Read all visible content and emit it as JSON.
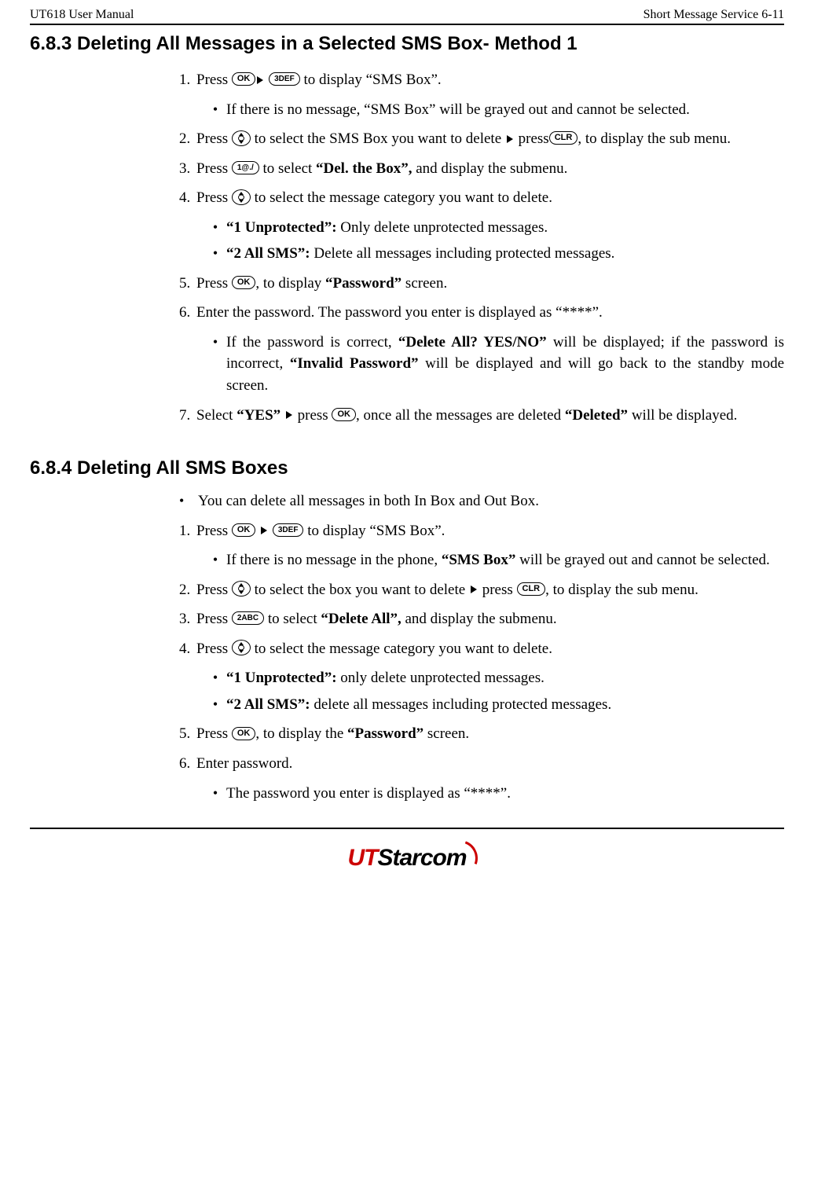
{
  "header": {
    "left": "UT618 User Manual",
    "right": "Short Message Service   6-11"
  },
  "section_683": {
    "title": "6.8.3 Deleting All Messages in a Selected SMS Box- Method 1",
    "steps": {
      "s1": {
        "num": "1.",
        "pre": "Press ",
        "post": " to display “SMS Box”.",
        "key_ok": "OK",
        "key_3": "3DEF",
        "bullet1": "If there is no message, “SMS Box” will be grayed out and cannot be selected."
      },
      "s2": {
        "num": "2.",
        "pre": "Press ",
        "mid1": " to select the SMS Box you want to delete ",
        "mid2": " press",
        "key_clr": "CLR",
        "post": ", to display the sub menu."
      },
      "s3": {
        "num": "3.",
        "pre": "Press ",
        "key_1": "1@./",
        "mid": " to select  ",
        "bold": "“Del. the Box”,",
        "post": " and display the submenu."
      },
      "s4": {
        "num": "4.",
        "pre": "Press ",
        "post": " to select the message category you want to delete.",
        "b1_bold": "“1 Unprotected”:",
        "b1_rest": " Only delete unprotected messages.",
        "b2_bold": "“2 All SMS”:",
        "b2_rest": " Delete all messages including protected messages."
      },
      "s5": {
        "num": "5.",
        "pre": "Press ",
        "key_ok": "OK",
        "mid": ", to display ",
        "bold": "“Password”",
        "post": " screen."
      },
      "s6": {
        "num": "6.",
        "text": "Enter the password. The password you enter is displayed as “****”.",
        "b1_pre": "If the password is correct, ",
        "b1_bold1": "“Delete All? YES/NO”",
        "b1_mid": " will be displayed; if the password is incorrect, ",
        "b1_bold2": "“Invalid Password”",
        "b1_post": " will be displayed and will go back to the standby mode screen."
      },
      "s7": {
        "num": "7.",
        "pre": "Select ",
        "bold_yes": "“YES”",
        "mid1": " press ",
        "key_ok": "OK",
        "mid2": ",  once all the messages are deleted ",
        "bold_del": "“Deleted”",
        "post": " will be displayed."
      }
    }
  },
  "section_684": {
    "title": "6.8.4 Deleting All SMS Boxes",
    "intro": "You can delete all messages in both In Box and Out Box.",
    "steps": {
      "s1": {
        "num": "1.",
        "pre": "Press ",
        "key_ok": "OK",
        "key_3": "3DEF",
        "post": " to display “SMS Box”.",
        "b1_pre": "If there is no message in the phone, ",
        "b1_bold": "“SMS Box”",
        "b1_post": " will be grayed out and cannot be selected."
      },
      "s2": {
        "num": "2.",
        "pre": "Press ",
        "mid1": " to select the box you want to delete ",
        "mid2": " press ",
        "key_clr": "CLR",
        "post": ", to display the sub menu."
      },
      "s3": {
        "num": "3.",
        "pre": "Press ",
        "key_2": "2ABC",
        "mid": " to select ",
        "bold": "“Delete All”,",
        "post": " and display the submenu."
      },
      "s4": {
        "num": "4.",
        "pre": "Press ",
        "post": " to select the message category you want to delete.",
        "b1_bold": "“1 Unprotected”:",
        "b1_rest": " only delete unprotected messages.",
        "b2_bold": "“2 All SMS”:",
        "b2_rest": " delete all messages including protected messages."
      },
      "s5": {
        "num": "5.",
        "pre": "Press ",
        "key_ok": "OK",
        "mid": ", to display the ",
        "bold": "“Password”",
        "post": " screen."
      },
      "s6": {
        "num": "6.",
        "text": "Enter password.",
        "b1": "The password you enter is displayed as “****”."
      }
    }
  },
  "logo": {
    "ut": "UT",
    "star": "Starcom"
  }
}
